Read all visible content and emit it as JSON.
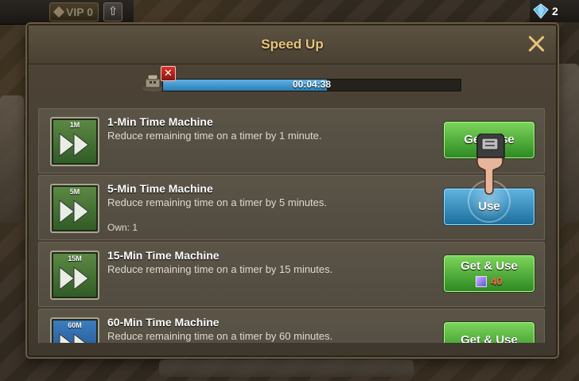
{
  "hud": {
    "vip_label": "VIP 0",
    "gem_count": "2"
  },
  "dialog": {
    "title": "Speed Up",
    "timer": "00:04:38",
    "progress": 0.55
  },
  "items": [
    {
      "tag": "1M",
      "title": "1-Min Time Machine",
      "desc": "Reduce remaining time on a timer by 1 minute.",
      "own": "",
      "button": "Get&Use",
      "cost": "",
      "button_style": "green",
      "icon_color": "green"
    },
    {
      "tag": "5M",
      "title": "5-Min Time Machine",
      "desc": "Reduce remaining time on a timer by 5 minutes.",
      "own": "Own: 1",
      "button": "Use",
      "cost": "",
      "button_style": "blue",
      "icon_color": "green"
    },
    {
      "tag": "15M",
      "title": "15-Min Time Machine",
      "desc": "Reduce remaining time on a timer by 15 minutes.",
      "own": "",
      "button": "Get & Use",
      "cost": "40",
      "button_style": "green",
      "icon_color": "green"
    },
    {
      "tag": "60M",
      "title": "60-Min Time Machine",
      "desc": "Reduce remaining time on a timer by 60 minutes.",
      "own": "",
      "button": "Get & Use",
      "cost": "",
      "button_style": "green",
      "icon_color": "blue"
    }
  ]
}
